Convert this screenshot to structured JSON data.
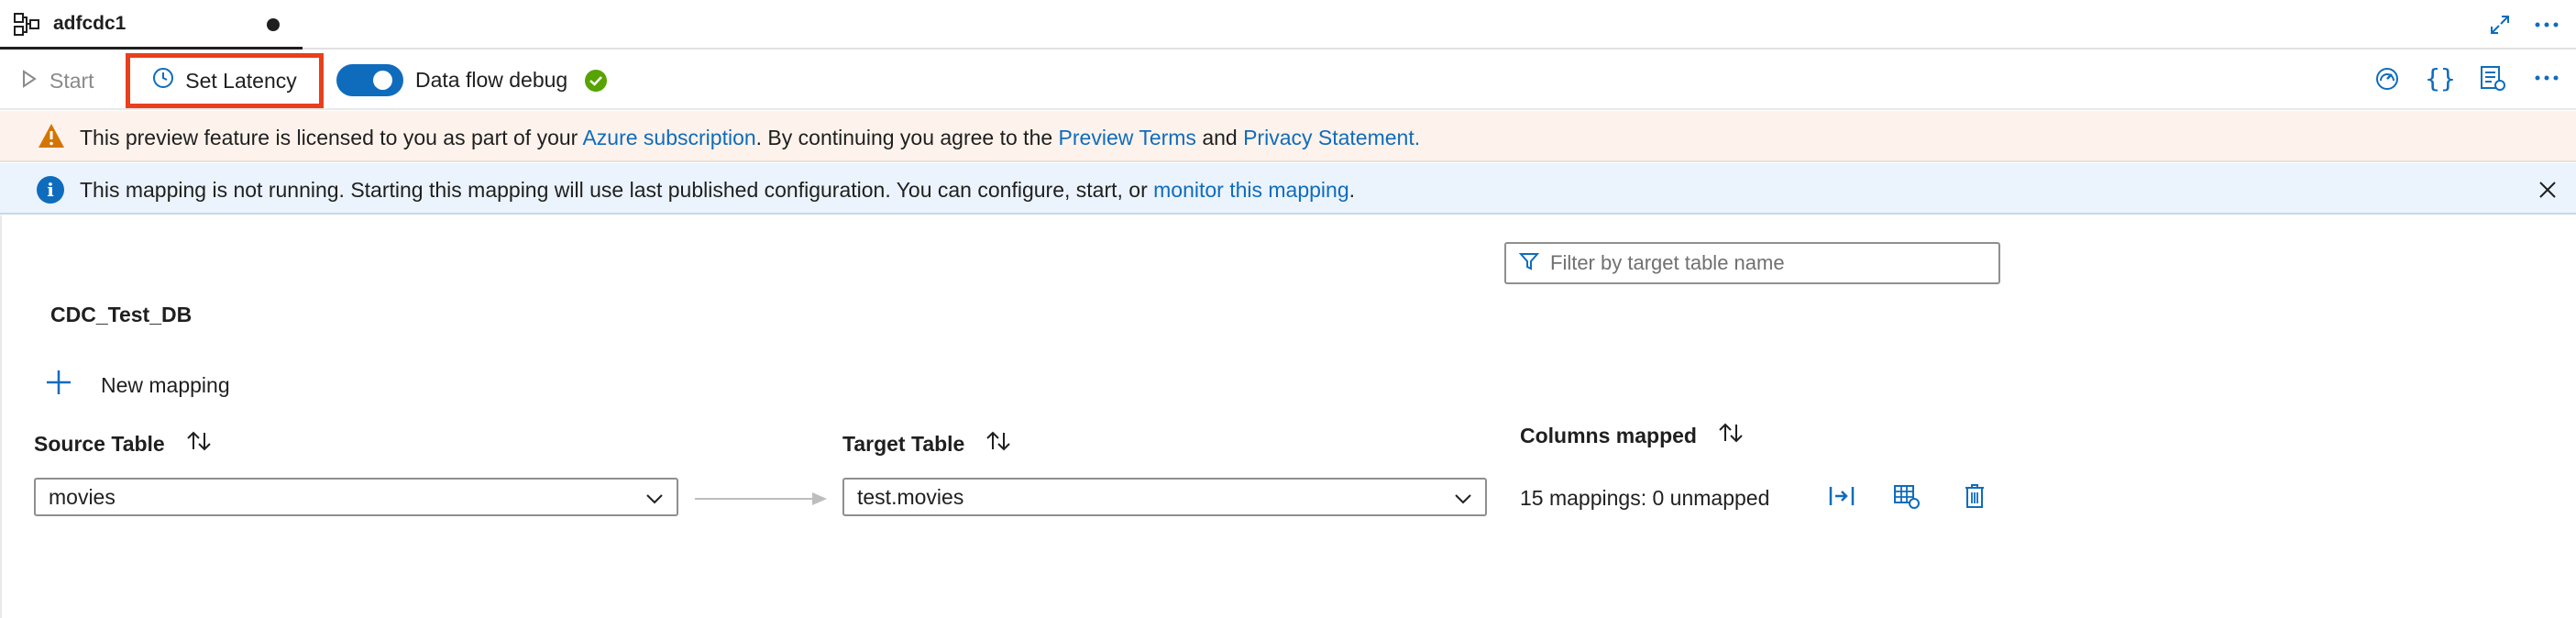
{
  "tab": {
    "title": "adfcdc1"
  },
  "toolbar": {
    "start_label": "Start",
    "set_latency_label": "Set Latency",
    "debug_label": "Data flow debug",
    "debug_on": true
  },
  "warning_banner": {
    "text_1": "This preview feature is licensed to you as part of your",
    "link_1": "Azure subscription",
    "text_2": ". By continuing you agree to the",
    "link_2": "Preview Terms",
    "text_3": "and",
    "link_3": "Privacy Statement."
  },
  "info_banner": {
    "text_1": "This mapping is not running. Starting this mapping will use last published configuration. You can configure, start, or",
    "link": "monitor this mapping",
    "text_2": "."
  },
  "filter": {
    "placeholder": "Filter by target table name",
    "value": ""
  },
  "database_name": "CDC_Test_DB",
  "new_mapping_label": "New mapping",
  "columns": {
    "source": "Source Table",
    "target": "Target Table",
    "mapped": "Columns mapped"
  },
  "mappings": [
    {
      "source": "movies",
      "target": "test.movies",
      "summary": "15 mappings: 0 unmapped"
    }
  ],
  "icons": {
    "tab": "dataflow-icon",
    "expand": "expand-icon",
    "more": "more-icon",
    "monitor": "gauge-icon",
    "code": "code-icon",
    "properties": "properties-icon"
  },
  "colors": {
    "accent": "#0f6cbd",
    "highlight": "#e8401c",
    "success": "#57a300",
    "warning": "#d47500",
    "warning_bg": "#fdf3ec",
    "info_bg": "#ebf3fc"
  }
}
